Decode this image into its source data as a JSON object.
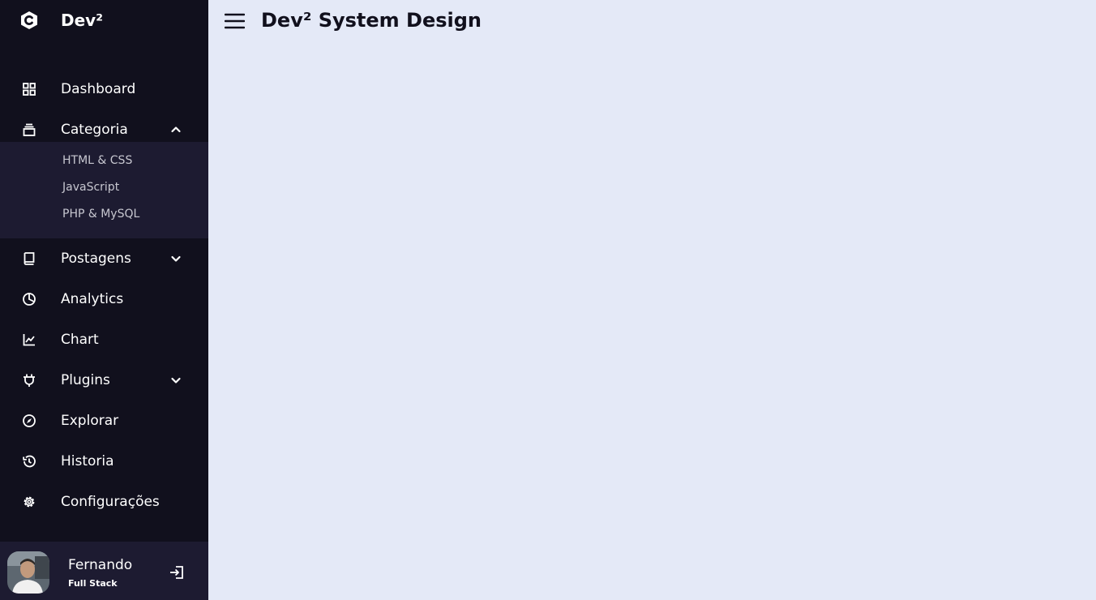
{
  "logo": {
    "name": "Dev²",
    "icon": "c-badge-icon"
  },
  "header": {
    "title": "Dev² System Design",
    "menu_icon": "hamburger-icon"
  },
  "nav": {
    "dashboard": "Dashboard",
    "categoria": "Categoria",
    "categoria_sub": [
      "HTML & CSS",
      "JavaScript",
      "PHP & MySQL"
    ],
    "postagens": "Postagens",
    "analytics": "Analytics",
    "chart": "Chart",
    "plugins": "Plugins",
    "explorar": "Explorar",
    "historia": "Historia",
    "configuracoes": "Configurações"
  },
  "profile": {
    "name": "Fernando",
    "job": "Full Stack"
  },
  "colors": {
    "sidebar": "#11101d",
    "submenu": "#1d1b31",
    "content": "#e4e9f7"
  }
}
